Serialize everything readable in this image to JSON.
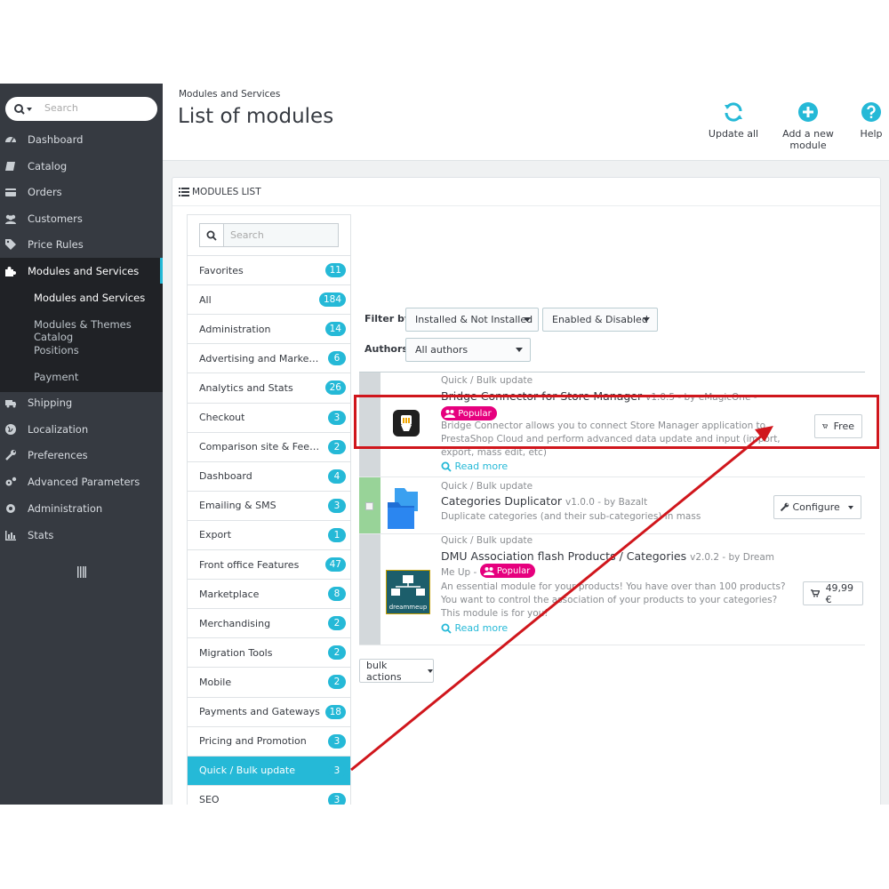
{
  "sidebar": {
    "search_placeholder": "Search",
    "items": [
      {
        "label": "Dashboard",
        "icon": "dashboard-icon"
      },
      {
        "label": "Catalog",
        "icon": "book-icon"
      },
      {
        "label": "Orders",
        "icon": "credit-card-icon"
      },
      {
        "label": "Customers",
        "icon": "users-icon"
      },
      {
        "label": "Price Rules",
        "icon": "tags-icon"
      },
      {
        "label": "Modules and Services",
        "icon": "puzzle-icon"
      },
      {
        "label": "Shipping",
        "icon": "truck-icon"
      },
      {
        "label": "Localization",
        "icon": "globe-icon"
      },
      {
        "label": "Preferences",
        "icon": "wrench-icon"
      },
      {
        "label": "Advanced Parameters",
        "icon": "cogs-icon"
      },
      {
        "label": "Administration",
        "icon": "gear-icon"
      },
      {
        "label": "Stats",
        "icon": "bar-chart-icon"
      }
    ],
    "submenu": [
      "Modules and Services",
      "Modules & Themes Catalog",
      "Positions",
      "Payment"
    ]
  },
  "header": {
    "breadcrumb": "Modules and Services",
    "title": "List of modules",
    "toolbar": [
      {
        "label": "Update all",
        "icon": "refresh-icon"
      },
      {
        "label": "Add a new module",
        "icon": "plus-circle-icon"
      },
      {
        "label": "Help",
        "icon": "help-icon"
      }
    ]
  },
  "panel": {
    "heading": "MODULES LIST",
    "category_search_placeholder": "Search",
    "categories": [
      {
        "label": "Favorites",
        "count": "11"
      },
      {
        "label": "All",
        "count": "184"
      },
      {
        "label": "Administration",
        "count": "14"
      },
      {
        "label": "Advertising and Marketing",
        "count": "6"
      },
      {
        "label": "Analytics and Stats",
        "count": "26"
      },
      {
        "label": "Checkout",
        "count": "3"
      },
      {
        "label": "Comparison site & Feed m...",
        "count": "2"
      },
      {
        "label": "Dashboard",
        "count": "4"
      },
      {
        "label": "Emailing & SMS",
        "count": "3"
      },
      {
        "label": "Export",
        "count": "1"
      },
      {
        "label": "Front office Features",
        "count": "47"
      },
      {
        "label": "Marketplace",
        "count": "8"
      },
      {
        "label": "Merchandising",
        "count": "2"
      },
      {
        "label": "Migration Tools",
        "count": "2"
      },
      {
        "label": "Mobile",
        "count": "2"
      },
      {
        "label": "Payments and Gateways",
        "count": "18"
      },
      {
        "label": "Pricing and Promotion",
        "count": "3"
      },
      {
        "label": "Quick / Bulk update",
        "count": "3"
      },
      {
        "label": "SEO",
        "count": "3"
      }
    ],
    "filters": {
      "filter_by_label": "Filter by",
      "install_select": "Installed & Not Installed",
      "enable_select": "Enabled & Disabled",
      "authors_label": "Authors",
      "authors_select": "All authors"
    },
    "modules": [
      {
        "category": "Quick / Bulk update",
        "name": "Bridge Connector for Store Manager",
        "version": "v1.0.5 - by eMagicOne -",
        "badge": "Popular",
        "description": [
          "Bridge Connector allows you to connect Store Manager application to",
          "PrestaShop Cloud and perform advanced data update and input (import,",
          "export, mass edit, etc)"
        ],
        "read_more": "Read more",
        "action": "Free"
      },
      {
        "category": "Quick / Bulk update",
        "name": "Categories Duplicator",
        "version": "v1.0.0 - by Bazalt",
        "description": [
          "Duplicate categories (and their sub-categories) in mass"
        ],
        "action": "Configure"
      },
      {
        "category": "Quick / Bulk update",
        "name": "DMU Association flash Products / Categories",
        "version": "v2.0.2 - by Dream",
        "name_line2": "Me Up -",
        "badge": "Popular",
        "description": [
          "An essential module for your products! You have over than 100 products?",
          "You want to control the association of your products to your categories?",
          "This module is for you!"
        ],
        "read_more": "Read more",
        "action": "49,99 €",
        "logo_text": "dreammeup"
      }
    ],
    "bulk_actions": "bulk actions"
  },
  "colors": {
    "accent": "#25b9d7",
    "sidebar": "#363a41",
    "popular": "#e6007e",
    "highlight": "#d0161c"
  }
}
